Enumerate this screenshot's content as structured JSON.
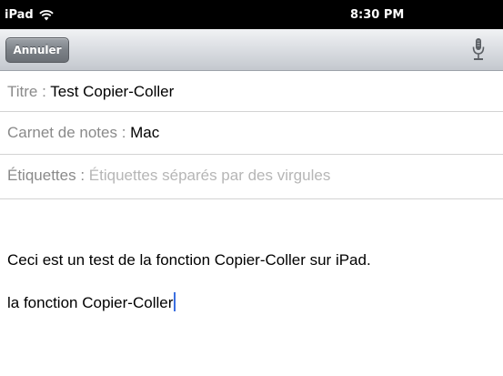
{
  "status_bar": {
    "device": "iPad",
    "time": "8:30 PM"
  },
  "toolbar": {
    "cancel_label": "Annuler",
    "mic_icon": "microphone-icon"
  },
  "fields": {
    "title": {
      "label": "Titre : ",
      "value": "Test Copier-Coller"
    },
    "notebook": {
      "label": "Carnet de notes : ",
      "value": "Mac"
    },
    "tags": {
      "label": "Étiquettes : ",
      "placeholder": "Étiquettes séparés par des virgules"
    }
  },
  "note": {
    "lines": [
      "Ceci est un test de la fonction Copier-Coller sur iPad.",
      "la fonction Copier-Coller"
    ]
  },
  "colors": {
    "cursor": "#3b6fe0",
    "label": "#8a8a8a",
    "placeholder": "#b6b6b6"
  }
}
